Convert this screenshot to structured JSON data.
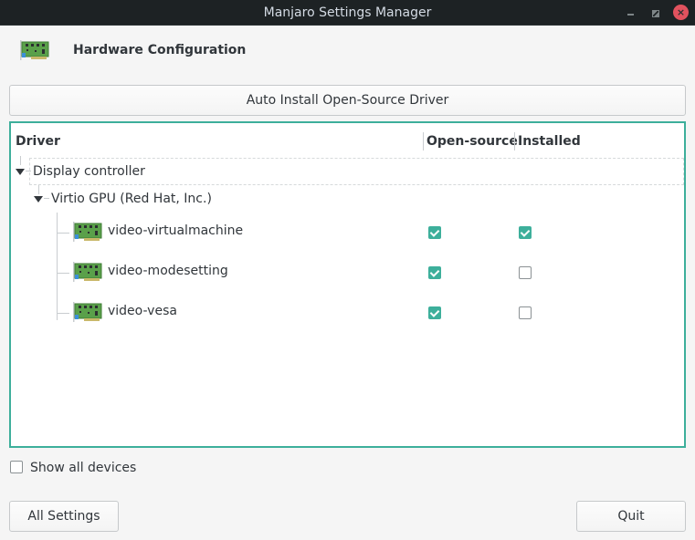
{
  "window": {
    "title": "Manjaro Settings Manager",
    "controls": [
      "minimize-icon",
      "maximize-icon",
      "close-icon"
    ]
  },
  "header": {
    "icon": "hardware-card-icon",
    "title": "Hardware Configuration"
  },
  "toolbar": {
    "auto_install_label": "Auto Install Open-Source Driver"
  },
  "tree": {
    "columns": [
      "Driver",
      "Open-source",
      "Installed"
    ],
    "category": {
      "label": "Display controller",
      "expanded": true
    },
    "device": {
      "label": "Virtio GPU (Red Hat, Inc.)",
      "expanded": true
    },
    "drivers": [
      {
        "name": "video-virtualmachine",
        "open_source": true,
        "installed": true
      },
      {
        "name": "video-modesetting",
        "open_source": true,
        "installed": false
      },
      {
        "name": "video-vesa",
        "open_source": true,
        "installed": false
      }
    ]
  },
  "options": {
    "show_all_devices_label": "Show all devices",
    "show_all_devices_checked": false
  },
  "footer": {
    "all_settings_label": "All Settings",
    "quit_label": "Quit"
  },
  "colors": {
    "accent": "#3daf9b",
    "titlebar": "#1d2224",
    "close": "#e2525e"
  }
}
